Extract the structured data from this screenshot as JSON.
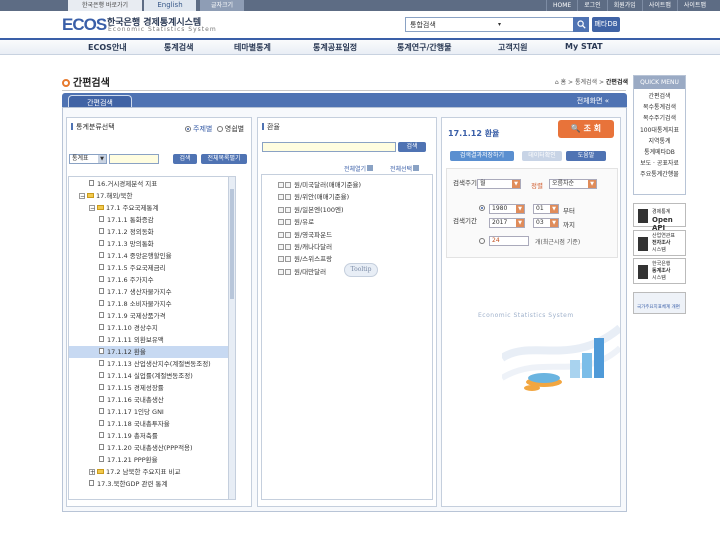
{
  "topbar": {
    "bok_link": "한국은행 바로가기",
    "english": "English",
    "zoom": "글자크기",
    "links": [
      "HOME",
      "로그인",
      "회원가입",
      "사이트맵",
      "사이트맵"
    ]
  },
  "logo": {
    "ecos": "ECOS",
    "kr": "한국은행 경제통계시스템",
    "en": "Economic Statistics System"
  },
  "search": {
    "placeholder": "통합검색",
    "button_icon": "search-icon",
    "tbtn": "폐타DB"
  },
  "nav": [
    "ECOS안내",
    "통계검색",
    "테마별통계",
    "통계공표일정",
    "통계연구/간행물",
    "고객지원",
    "My STAT"
  ],
  "page": {
    "title": "간편검색",
    "breadcrumb_home": "홈",
    "breadcrumb_mid": "통계검색",
    "breadcrumb_cur": "간편검색"
  },
  "tabs": {
    "active": "간편검색",
    "expand": "전체화면 «"
  },
  "left": {
    "head": "통계분류선택",
    "radio_on": "주제별",
    "radio_off": "영쉽별",
    "select": "통계표",
    "search_btn": "검색",
    "collapse_btn": "전체목록펼기",
    "tree": [
      {
        "label": "16.거시경제분석 지표",
        "indent": 1,
        "kind": "doc",
        "mark": "none"
      },
      {
        "label": "17.해외/북한",
        "indent": 0,
        "kind": "folder",
        "mark": "minus"
      },
      {
        "label": "17.1 주요국제통계",
        "indent": 1,
        "kind": "folder",
        "mark": "minus"
      },
      {
        "label": "17.1.1 통화증감",
        "indent": 2,
        "kind": "doc",
        "mark": "none"
      },
      {
        "label": "17.1.2 정외동화",
        "indent": 2,
        "kind": "doc",
        "mark": "none"
      },
      {
        "label": "17.1.3 망의통화",
        "indent": 2,
        "kind": "doc",
        "mark": "none"
      },
      {
        "label": "17.1.4 중앙은행할인율",
        "indent": 2,
        "kind": "doc",
        "mark": "none"
      },
      {
        "label": "17.1.5 주요국제금리",
        "indent": 2,
        "kind": "doc",
        "mark": "none"
      },
      {
        "label": "17.1.6 주가지수",
        "indent": 2,
        "kind": "doc",
        "mark": "none"
      },
      {
        "label": "17.1.7 생산자물가지수",
        "indent": 2,
        "kind": "doc",
        "mark": "none"
      },
      {
        "label": "17.1.8 소비자물가지수",
        "indent": 2,
        "kind": "doc",
        "mark": "none"
      },
      {
        "label": "17.1.9 국제상품가격",
        "indent": 2,
        "kind": "doc",
        "mark": "none"
      },
      {
        "label": "17.1.10 경상수지",
        "indent": 2,
        "kind": "doc",
        "mark": "none"
      },
      {
        "label": "17.1.11 외환보유액",
        "indent": 2,
        "kind": "doc",
        "mark": "none"
      },
      {
        "label": "17.1.12 환율",
        "indent": 2,
        "kind": "doc",
        "mark": "none",
        "selected": true
      },
      {
        "label": "17.1.13 산업생산지수(계절변동조정)",
        "indent": 2,
        "kind": "doc",
        "mark": "none"
      },
      {
        "label": "17.1.14 실업률(계절변동조정)",
        "indent": 2,
        "kind": "doc",
        "mark": "none"
      },
      {
        "label": "17.1.15 경제성장률",
        "indent": 2,
        "kind": "doc",
        "mark": "none"
      },
      {
        "label": "17.1.16 국내총생산",
        "indent": 2,
        "kind": "doc",
        "mark": "none"
      },
      {
        "label": "17.1.17 1인당 GNI",
        "indent": 2,
        "kind": "doc",
        "mark": "none"
      },
      {
        "label": "17.1.18 국내총투자율",
        "indent": 2,
        "kind": "doc",
        "mark": "none"
      },
      {
        "label": "17.1.19 총저축률",
        "indent": 2,
        "kind": "doc",
        "mark": "none"
      },
      {
        "label": "17.1.20 국내총생산(PPP적용)",
        "indent": 2,
        "kind": "doc",
        "mark": "none"
      },
      {
        "label": "17.1.21 PPP환율",
        "indent": 2,
        "kind": "doc",
        "mark": "none"
      },
      {
        "label": "17.2 남북한 주요지표 비교",
        "indent": 1,
        "kind": "folder",
        "mark": "plus"
      },
      {
        "label": "17.3.북한GDP 관련 통계",
        "indent": 1,
        "kind": "doc",
        "mark": "none"
      }
    ]
  },
  "middle": {
    "head": "환율",
    "search_btn": "검색",
    "expand_all": "전체열기",
    "select_all": "전체선택",
    "items": [
      "원/미국달러(매매기준율)",
      "원/위안(매매기준율)",
      "원/일본엔(100엔)",
      "원/유로",
      "원/영국파운드",
      "원/캐나다달러",
      "원/스위스프랑",
      "원/대만달러"
    ],
    "tooltip": "Tooltip"
  },
  "right": {
    "head": "17.1.12 환율",
    "query_btn": "조 회",
    "btn1": "검색결과저장하기",
    "btn2": "데이터확인",
    "btn3": "도움말",
    "cycle_label": "검색주기",
    "cycle_value": "월",
    "sort_label": "정렬",
    "sort_value": "오름차순",
    "period_label": "검색기간",
    "from_year": "1980",
    "from_month": "01",
    "from_suffix": "부터",
    "to_year": "2017",
    "to_month": "03",
    "to_suffix": "까지",
    "recent_count": "24",
    "recent_suffix": "개(최근시점 기준)",
    "watermark": "Economic Statistics System"
  },
  "quick": {
    "head": "QUICK MENU",
    "items": [
      "간편검색",
      "복수통계검색",
      "복수주기검색",
      "100대통계지표",
      "지역통계",
      "통계메타DB",
      "보도 · 공표자료",
      "주요통계간행물"
    ]
  },
  "side": {
    "openapi1": "경제통계",
    "openapi2": "Open API",
    "biz1": "산업연관표",
    "biz2": "전자조사",
    "biz3": "시스템",
    "cons1": "한국은행",
    "cons2": "동계조사",
    "cons3": "시스템",
    "nat": "국가주요지표체계 개편"
  }
}
